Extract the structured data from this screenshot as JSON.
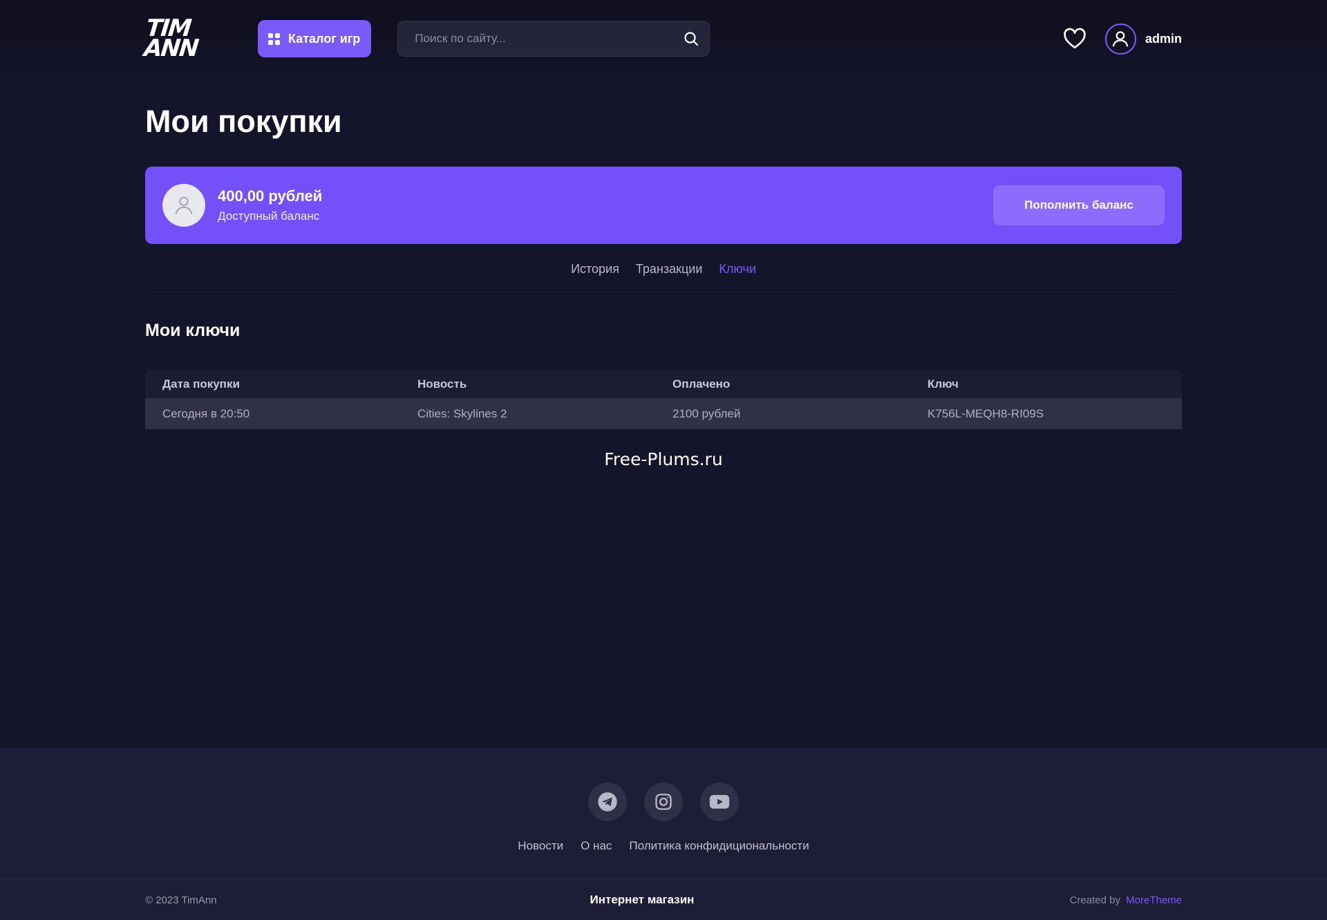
{
  "header": {
    "logo_line1": "TIM",
    "logo_line2": "ANN",
    "catalog_label": "Каталог игр",
    "search_placeholder": "Поиск по сайту...",
    "username": "admin"
  },
  "page": {
    "title": "Мои покупки"
  },
  "balance": {
    "amount": "400,00 рублей",
    "label": "Доступный баланс",
    "topup_label": "Пополнить баланс"
  },
  "tabs": [
    {
      "label": "История",
      "active": false
    },
    {
      "label": "Транзакции",
      "active": false
    },
    {
      "label": "Ключи",
      "active": true
    }
  ],
  "keys_section": {
    "title": "Мои ключи",
    "columns": [
      "Дата покупки",
      "Новость",
      "Оплачено",
      "Ключ"
    ],
    "rows": [
      [
        "Сегодня в 20:50",
        "Cities: Skylines 2",
        "2100 рублей",
        "K756L-MEQH8-RI09S"
      ]
    ]
  },
  "watermark": "Free-Plums.ru",
  "footer": {
    "socials": [
      "telegram-icon",
      "instagram-icon",
      "youtube-icon"
    ],
    "links": [
      "Новости",
      "О нас",
      "Политика конфидициональности"
    ],
    "copyright": "© 2023 TimAnn",
    "shop_label": "Интернет магазин",
    "created_by": "Created by",
    "creator": "MoreTheme"
  },
  "colors": {
    "background": "#14142a",
    "accent": "#7a5af8",
    "card": "#7450fa",
    "footer": "#1d1d37"
  }
}
